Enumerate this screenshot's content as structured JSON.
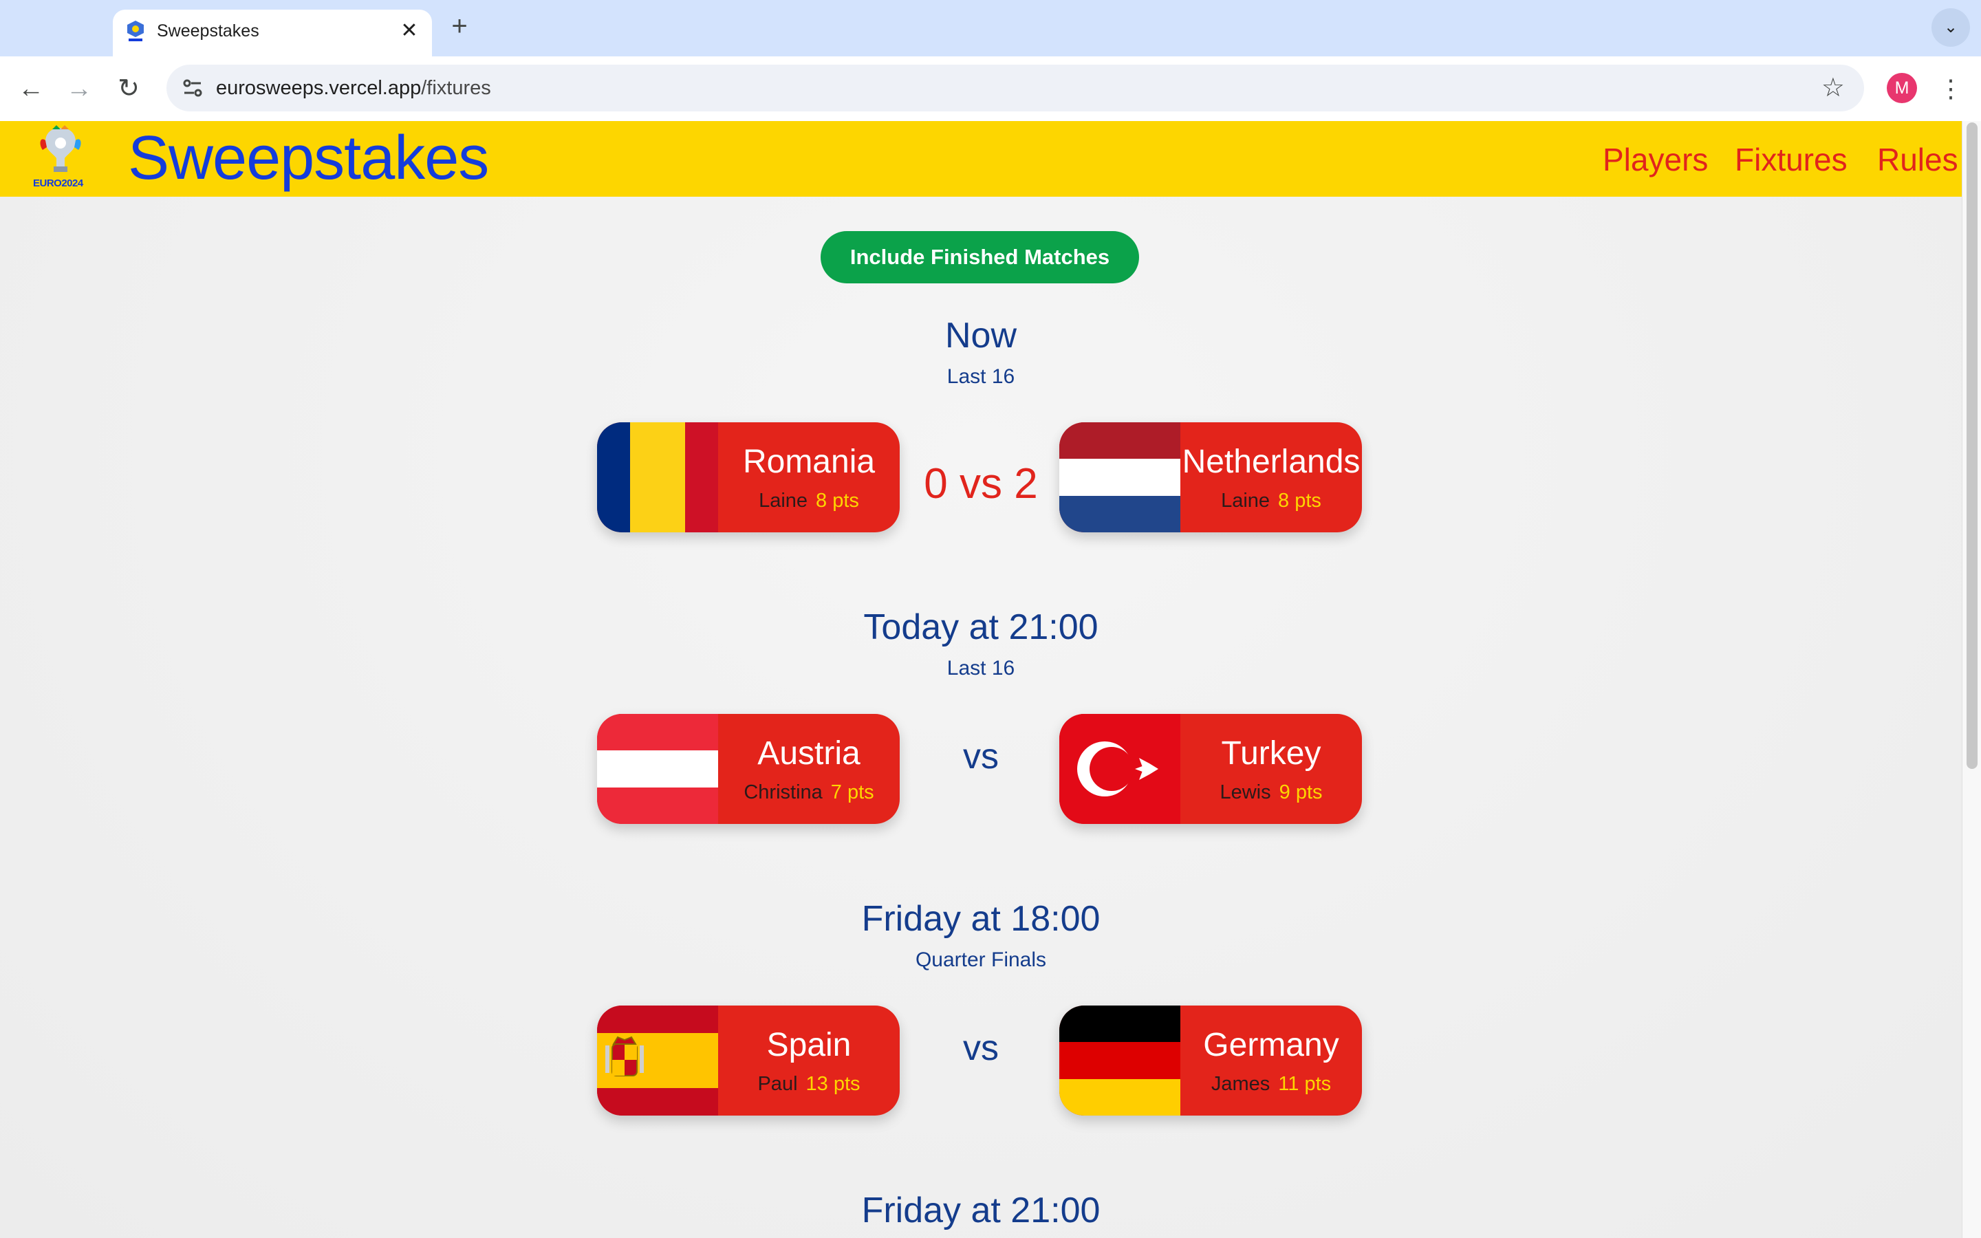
{
  "browser": {
    "tab_title": "Sweepstakes",
    "url_host": "eurosweeps.vercel.app",
    "url_path": "/fixtures",
    "profile_initial": "M"
  },
  "site": {
    "logo_text": "EURO2024",
    "title": "Sweepstakes",
    "nav": [
      "Players",
      "Fixtures",
      "Rules"
    ],
    "filter_button": "Include Finished Matches"
  },
  "fixtures": [
    {
      "when": "Now",
      "stage": "Last 16",
      "score": "0 vs 2",
      "home": {
        "team": "Romania",
        "owner": "Laine",
        "points": "8 pts"
      },
      "away": {
        "team": "Netherlands",
        "owner": "Laine",
        "points": "8 pts"
      }
    },
    {
      "when": "Today at 21:00",
      "stage": "Last 16",
      "vs": "vs",
      "home": {
        "team": "Austria",
        "owner": "Christina",
        "points": "7 pts"
      },
      "away": {
        "team": "Turkey",
        "owner": "Lewis",
        "points": "9 pts"
      }
    },
    {
      "when": "Friday at 18:00",
      "stage": "Quarter Finals",
      "vs": "vs",
      "home": {
        "team": "Spain",
        "owner": "Paul",
        "points": "13 pts"
      },
      "away": {
        "team": "Germany",
        "owner": "James",
        "points": "11 pts"
      }
    },
    {
      "when": "Friday at 21:00"
    }
  ],
  "colors": {
    "header_bg": "#fdd600",
    "title_blue": "#143cdb",
    "accent_red": "#e1241c",
    "card_red": "#e3241b",
    "button_green": "#0ba24a",
    "heading_blue": "#143c8c"
  }
}
